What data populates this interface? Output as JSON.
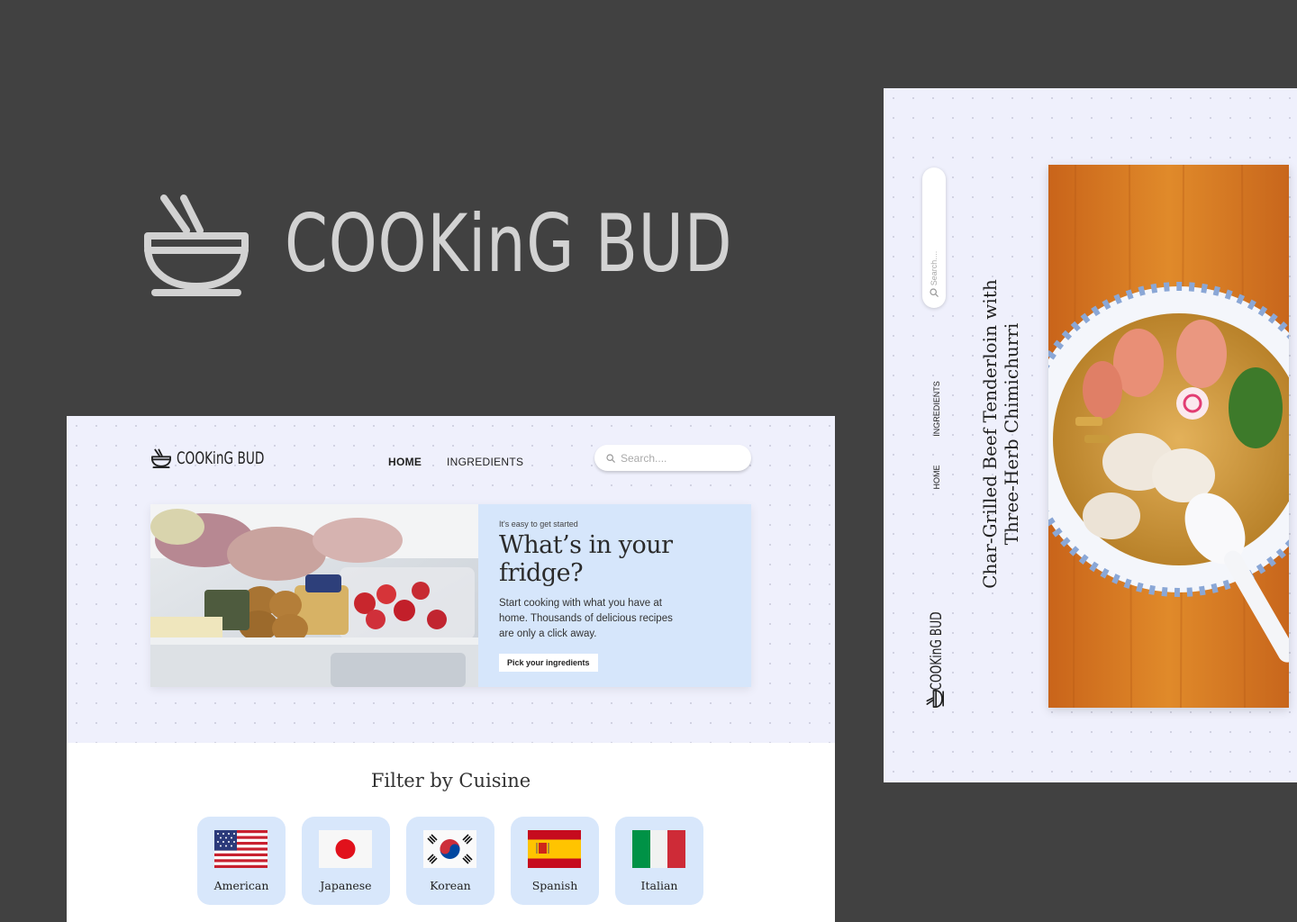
{
  "brand": {
    "name": "COOKinG BUD"
  },
  "main": {
    "nav": {
      "logo": "COOKinG BUD",
      "home": "HOME",
      "ingredients": "INGREDIENTS"
    },
    "search": {
      "placeholder": "Search...."
    },
    "hero": {
      "eyebrow": "It's easy to get started",
      "title": "What’s in your fridge?",
      "description": "Start cooking with what you have at home. Thousands of delicious recipes are only a click away.",
      "button": "Pick your ingredients"
    },
    "filter": {
      "title": "Filter by Cuisine",
      "cuisines": [
        {
          "label": "American",
          "flag_icon": "us-flag-icon"
        },
        {
          "label": "Japanese",
          "flag_icon": "japan-flag-icon"
        },
        {
          "label": "Korean",
          "flag_icon": "korea-flag-icon"
        },
        {
          "label": "Spanish",
          "flag_icon": "spain-flag-icon"
        },
        {
          "label": "Italian",
          "flag_icon": "italy-flag-icon"
        }
      ]
    }
  },
  "side": {
    "search_placeholder": "Search....",
    "nav": {
      "ingredients": "INGREDIENTS",
      "home": "HOME"
    },
    "logo": "COOKinG BUD",
    "dish_title_line1": "Char-Grilled Beef Tenderloin with",
    "dish_title_line2": "Three-Herb Chimichurri"
  },
  "colors": {
    "background": "#414141",
    "panel": "#eff0fc",
    "accent_blue": "#d6e6fb",
    "logo_gray": "#d2d2d2"
  }
}
